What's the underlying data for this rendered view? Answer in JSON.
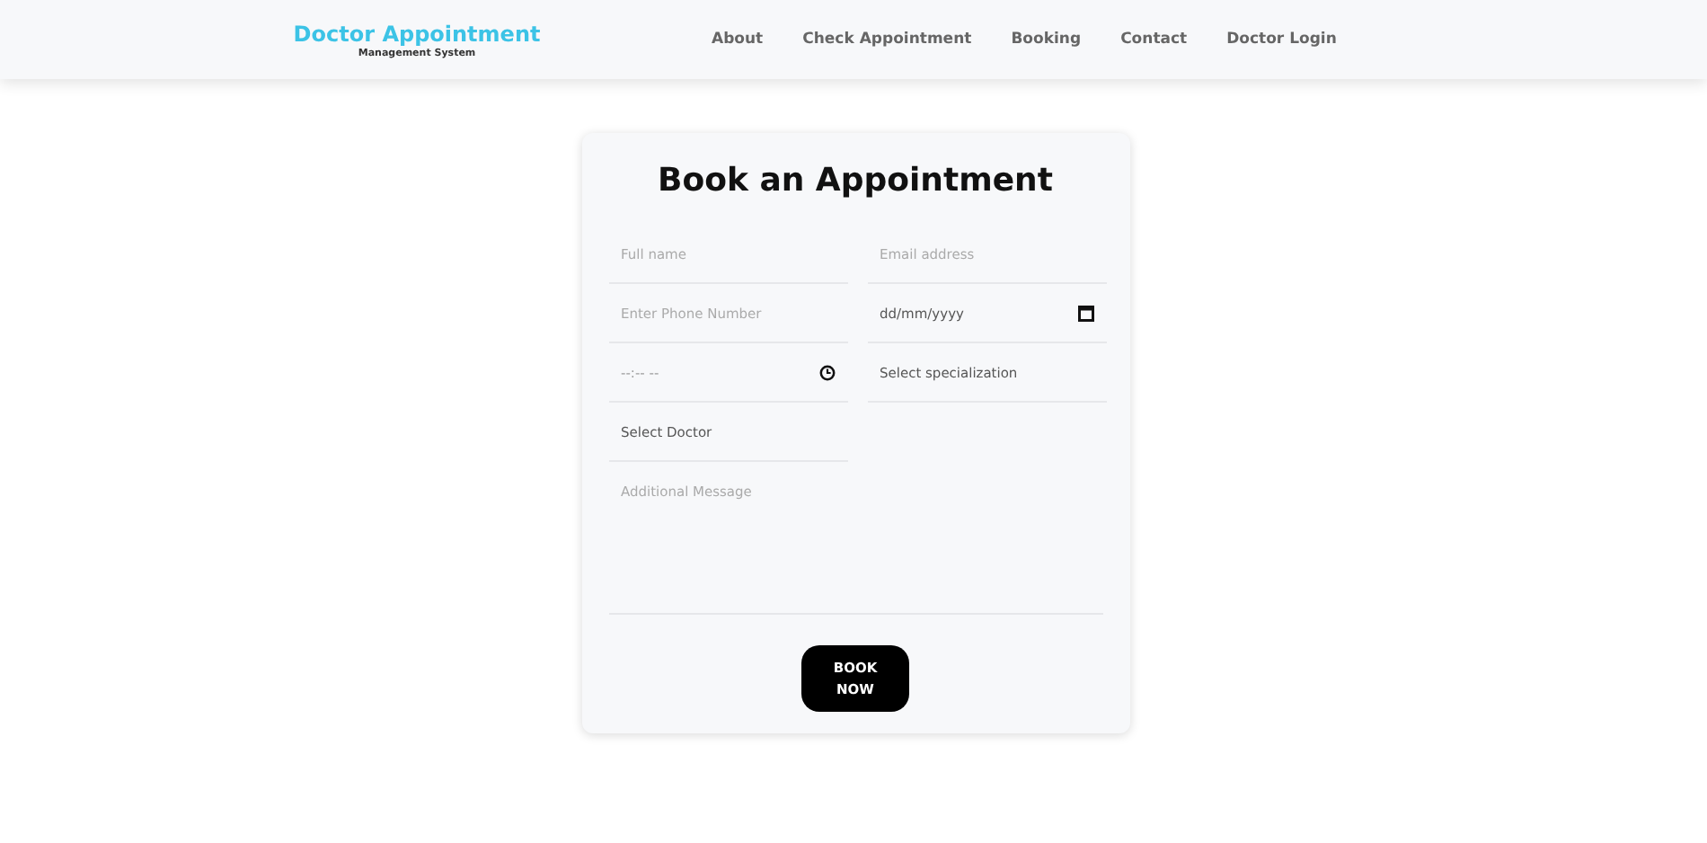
{
  "header": {
    "brand": "Doctor Appointment",
    "tagline": "Management System",
    "nav": [
      "About",
      "Check Appointment",
      "Booking",
      "Contact",
      "Doctor Login"
    ]
  },
  "form": {
    "title": "Book an Appointment",
    "fields": [
      {
        "kind": "text",
        "placeholder": "Full name"
      },
      {
        "kind": "text",
        "placeholder": "Email address"
      },
      {
        "kind": "text",
        "placeholder": "Enter Phone Number"
      },
      {
        "kind": "date",
        "value": "dd/mm/yyyy"
      },
      {
        "kind": "time",
        "value": "--:-- --"
      },
      {
        "kind": "select",
        "value": "Select specialization"
      },
      {
        "kind": "select",
        "value": "Select Doctor"
      }
    ],
    "message": {
      "placeholder": "Additional Message"
    },
    "button": "BOOK NOW"
  }
}
